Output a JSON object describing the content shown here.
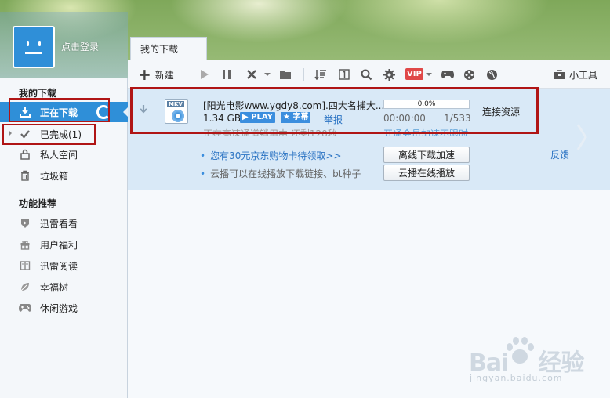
{
  "user": {
    "login_label": "点击登录"
  },
  "tabs": [
    {
      "label": "我的下载"
    }
  ],
  "sidebar": {
    "section_downloads": "我的下载",
    "items": [
      {
        "label": "正在下载",
        "icon": "download-tray-icon"
      },
      {
        "label": "已完成(1)",
        "icon": "checkmark-icon"
      },
      {
        "label": "私人空间",
        "icon": "lock-icon"
      },
      {
        "label": "垃圾箱",
        "icon": "trash-icon"
      }
    ],
    "section_features": "功能推荐",
    "features": [
      {
        "label": "迅雷看看",
        "icon": "play-shield-icon"
      },
      {
        "label": "用户福利",
        "icon": "gift-icon"
      },
      {
        "label": "迅雷阅读",
        "icon": "book-icon"
      },
      {
        "label": "幸福树",
        "icon": "leaf-icon"
      },
      {
        "label": "休闲游戏",
        "icon": "gamepad-icon"
      }
    ]
  },
  "toolbar": {
    "new_label": "新建",
    "tools_label": "小工具",
    "vip_label": "VIP"
  },
  "task": {
    "title": "[阳光电影www.ygdy8.com].四大名捕大...",
    "size": "1.34 GB",
    "play_badge": "PLAY",
    "subtitle_badge": "字幕",
    "report": "举报",
    "progress_text": "0.0%",
    "progress": 0.0,
    "elapsed": "00:00:00",
    "count": "1/533",
    "status": "连接资源",
    "subline_left": "正在高速通道锁用中 还剩120秒",
    "subline_right": "开通会员加速不限时",
    "file_type": "MKV"
  },
  "promos": [
    {
      "text": "您有30元京东购物卡待领取>>"
    },
    {
      "text": "云播可以在线播放下载链接、bt种子"
    }
  ],
  "buttons": {
    "offline_accel": "离线下载加速",
    "cloud_play": "云播在线播放",
    "feedback": "反馈"
  },
  "watermark": {
    "brand": "Bai",
    "brand2": "经验",
    "url": "jingyan.baidu.com"
  },
  "colors": {
    "accent": "#2f8fd8",
    "highlight_box": "#b01515",
    "link": "#2a73c3"
  }
}
